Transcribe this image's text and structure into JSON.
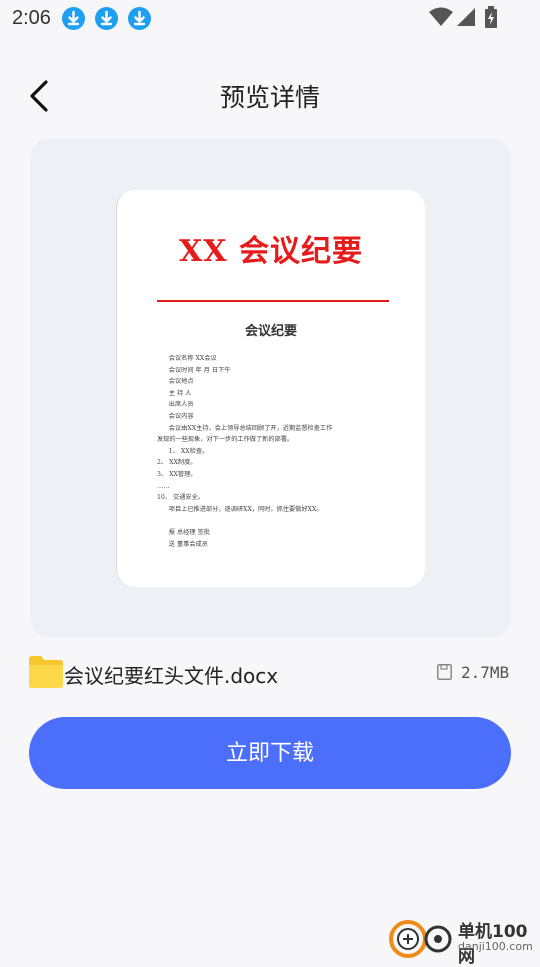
{
  "status": {
    "time": "2:06"
  },
  "header": {
    "title": "预览详情"
  },
  "preview": {
    "heading": "XX 会议纪要",
    "subtitle": "会议纪要",
    "body": "      会议名称 XX会议\n      会议时间 年 月 日下午\n      会议地点\n      主 持 人\n      出席人员\n      会议内容\n      会议由XX主持，会上领导总结回顾了开，近期监督检查工作\n发现的一些现象，对下一步的工作做了新的部署。\n      1、 XX检查。\n2、 XX制度。\n3、 XX管理。\n……\n10、 交通安全。\n      项目上已推进部分，逐调研XX，同时，抓住要做好XX。\n\n      报 总经理 签批\n      送 董事会成员"
  },
  "file": {
    "name": "会议纪要红头文件.docx",
    "size": "2.7MB"
  },
  "action": {
    "download_label": "立即下载"
  },
  "watermark": {
    "brand": "单机100网",
    "domain": "danji100.com"
  },
  "colors": {
    "accent": "#4b6ffb",
    "doc_red": "#e61c1c",
    "download_icon": "#1e9ff2"
  },
  "icons": [
    "download-icon",
    "wifi-icon",
    "signal-icon",
    "battery-icon",
    "back-icon",
    "folder-icon",
    "save-icon"
  ]
}
